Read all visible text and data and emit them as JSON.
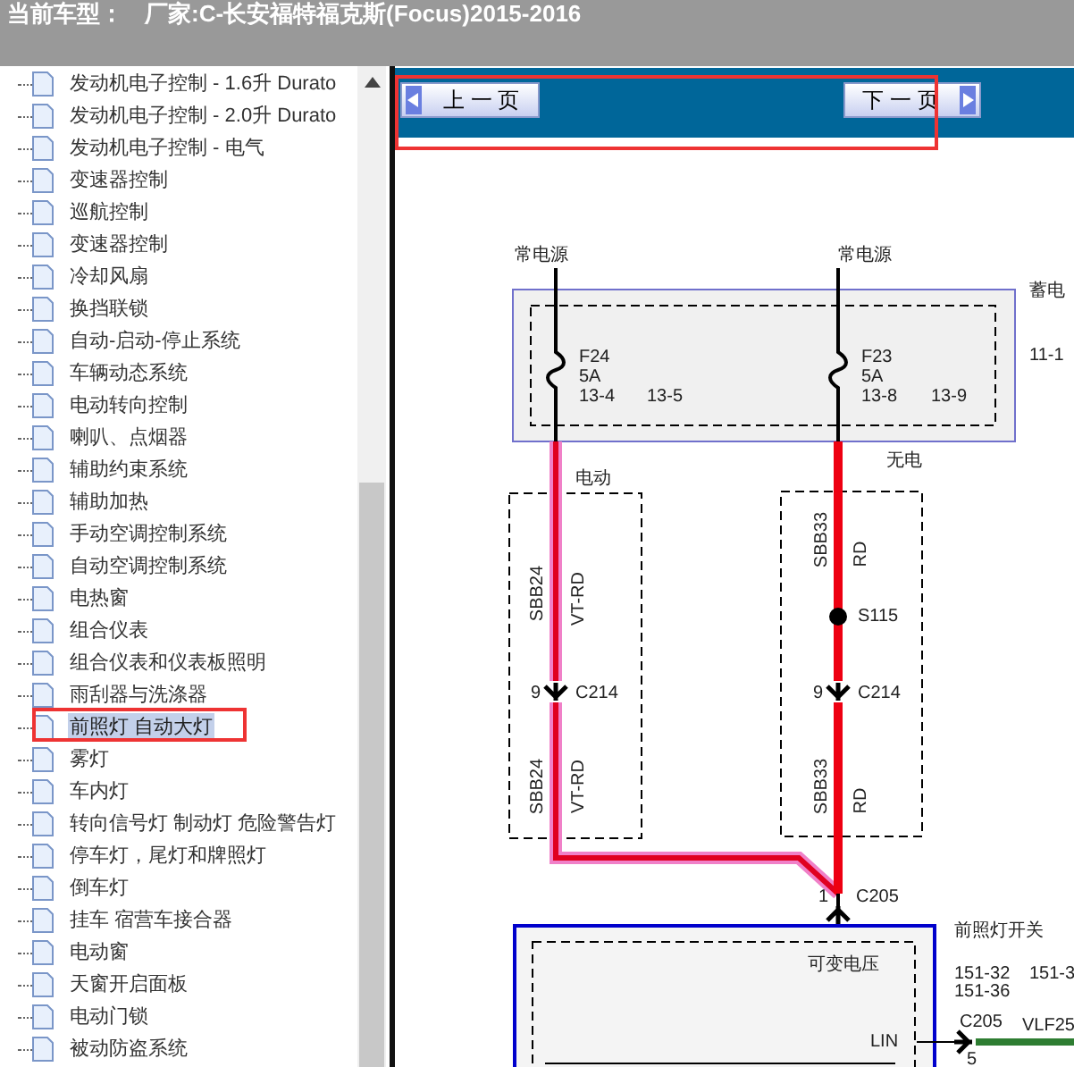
{
  "header": {
    "label": "当前车型：",
    "value": "厂家:C-长安福特福克斯(Focus)2015-2016"
  },
  "tree": {
    "items": [
      {
        "label": "发动机电子控制 - 1.6升 Durato",
        "selected": false
      },
      {
        "label": "发动机电子控制 - 2.0升 Durato",
        "selected": false
      },
      {
        "label": "发动机电子控制 - 电气",
        "selected": false
      },
      {
        "label": "变速器控制",
        "selected": false
      },
      {
        "label": "巡航控制",
        "selected": false
      },
      {
        "label": "变速器控制",
        "selected": false
      },
      {
        "label": "冷却风扇",
        "selected": false
      },
      {
        "label": "换挡联锁",
        "selected": false
      },
      {
        "label": "自动-启动-停止系统",
        "selected": false
      },
      {
        "label": "车辆动态系统",
        "selected": false
      },
      {
        "label": "电动转向控制",
        "selected": false
      },
      {
        "label": "喇叭、点烟器",
        "selected": false
      },
      {
        "label": "辅助约束系统",
        "selected": false
      },
      {
        "label": "辅助加热",
        "selected": false
      },
      {
        "label": "手动空调控制系统",
        "selected": false
      },
      {
        "label": "自动空调控制系统",
        "selected": false
      },
      {
        "label": "电热窗",
        "selected": false
      },
      {
        "label": "组合仪表",
        "selected": false
      },
      {
        "label": "组合仪表和仪表板照明",
        "selected": false
      },
      {
        "label": "雨刮器与洗涤器",
        "selected": false
      },
      {
        "label": "前照灯 自动大灯",
        "selected": true
      },
      {
        "label": "雾灯",
        "selected": false
      },
      {
        "label": "车内灯",
        "selected": false
      },
      {
        "label": "转向信号灯 制动灯 危险警告灯",
        "selected": false
      },
      {
        "label": "停车灯，尾灯和牌照灯",
        "selected": false
      },
      {
        "label": "倒车灯",
        "selected": false
      },
      {
        "label": "挂车 宿营车接合器",
        "selected": false
      },
      {
        "label": "电动窗",
        "selected": false
      },
      {
        "label": "天窗开启面板",
        "selected": false
      },
      {
        "label": "电动门锁",
        "selected": false
      },
      {
        "label": "被动防盗系统",
        "selected": false
      }
    ]
  },
  "toolbar": {
    "prev": "上 一 页",
    "next": "下 一 页"
  },
  "diagram": {
    "labels": [
      "常电源",
      "常电源",
      "蓄电",
      "F24",
      "5A",
      "13-4",
      "13-5",
      "F23",
      "5A",
      "13-8",
      "13-9",
      "11-1",
      "电动",
      "无电",
      "SBB24",
      "VT-RD",
      "9",
      "C214",
      "SBB24",
      "VT-RD",
      "SBB33",
      "RD",
      "S115",
      "9",
      "C214",
      "SBB33",
      "RD",
      "1",
      "C205",
      "可变电压",
      "前照灯开关",
      "151-32",
      "151-3",
      "151-36",
      "C205",
      "VLF25",
      "LIN",
      "5"
    ]
  }
}
